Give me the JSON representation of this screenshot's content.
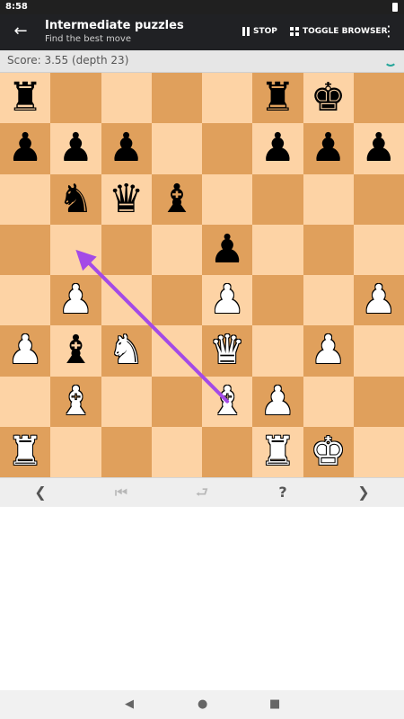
{
  "status_bar": {
    "time": "8:58"
  },
  "toolbar": {
    "title": "Intermediate puzzles",
    "subtitle": "Find the best move",
    "stop_label": "STOP",
    "toggle_browser_label": "TOGGLE BROWSER"
  },
  "score": {
    "text": "Score: 3.55 (depth 23)"
  },
  "board": {
    "light_square_color": "#fdd3a5",
    "dark_square_color": "#e0a05c",
    "arrow_color": "#a44ae6",
    "hint_arrow": {
      "from": "e2",
      "to": "b5"
    },
    "rows": [
      [
        "r",
        "",
        "",
        "",
        "",
        "r",
        "k",
        ""
      ],
      [
        "p",
        "p",
        "p",
        "",
        "",
        "p",
        "p",
        "p"
      ],
      [
        "",
        "n",
        "q",
        "b",
        "",
        "",
        "",
        ""
      ],
      [
        "",
        "",
        "",
        "",
        "p",
        "",
        "",
        ""
      ],
      [
        "",
        "P",
        "",
        "",
        "P",
        "",
        "",
        "P"
      ],
      [
        "P",
        "b",
        "N",
        "",
        "Q",
        "",
        "P",
        ""
      ],
      [
        "",
        "B",
        "",
        "",
        "B",
        "P",
        "",
        ""
      ],
      [
        "R",
        "",
        "",
        "",
        "",
        "R",
        "K",
        ""
      ]
    ]
  },
  "nav_bar": {
    "prev_icon": "chevron-left-icon",
    "first_icon": "skip-to-start-icon",
    "undo_icon": "undo-icon",
    "hint_icon": "question-mark-icon",
    "next_icon": "chevron-right-icon"
  },
  "system_nav": {
    "back_icon": "triangle-back-icon",
    "home_icon": "circle-home-icon",
    "recents_icon": "square-recents-icon"
  }
}
